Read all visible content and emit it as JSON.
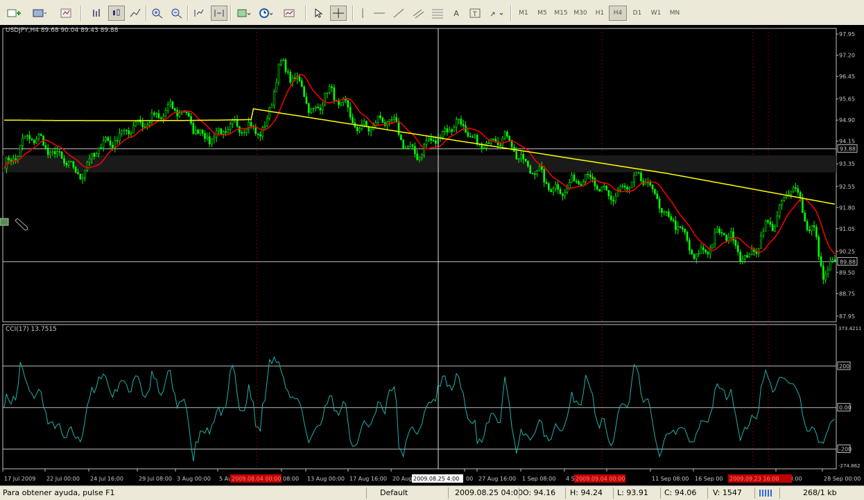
{
  "toolbar": {
    "timeframes": [
      "M1",
      "M5",
      "M15",
      "M30",
      "H1",
      "H4",
      "D1",
      "W1",
      "MN"
    ],
    "active_timeframe": "H4"
  },
  "chart": {
    "title": "USDJPY,H4  89.68 90.04 89.43 89.88",
    "indicator_label": "CCI(17) 13.7515",
    "price_axis": [
      "97.95",
      "97.20",
      "96.45",
      "95.65",
      "94.90",
      "94.15",
      "93.35",
      "92.55",
      "91.80",
      "91.05",
      "90.25",
      "89.50",
      "88.75",
      "87.95"
    ],
    "price_marker_top": "93.88",
    "price_marker_bottom": "89.88",
    "cci_axis": {
      "top": "373.4211",
      "upper": "200",
      "zero": "0.00",
      "lower": "-200",
      "bottom": "-274.862"
    },
    "time_axis": [
      "17 Jul 2009",
      "22 Jul 00:00",
      "24 Jul 16:00",
      "29 Jul 08:00",
      "3 Aug 00:00",
      "5 Au",
      "08:00",
      "13 Aug 00:00",
      "17 Aug 16:00",
      "20 Aug",
      "00",
      "27 Aug 16:00",
      "1 Sep 08:00",
      "4 Se",
      "6:00",
      "11 Sep 08:00",
      "16 Sep 00",
      "ep 08:00",
      "28 Sep 00:00"
    ],
    "time_highlights": [
      "2009.08.04 00:00",
      "2009.08.25 4:00",
      "2009.09.04 00:00",
      "2009.09.23 16:00"
    ],
    "crosshair_time": "2009.08.25 4:00",
    "colors": {
      "background": "#000000",
      "candles": "#00ff00",
      "ma_fast": "#ff0000",
      "ma_slow": "#ffff00",
      "cci": "#20b2aa",
      "grid_line": "#c0c0c0",
      "period_sep": "#800000"
    }
  },
  "status": {
    "help": "Para obtener ayuda, pulse F1",
    "profile": "Default",
    "datetime": "2009.08.25 04:00",
    "open": "O: 94.16",
    "high": "H: 94.24",
    "low": "L: 93.91",
    "close": "C: 94.06",
    "volume": "V: 1547",
    "traffic": "268/1 kb"
  }
}
